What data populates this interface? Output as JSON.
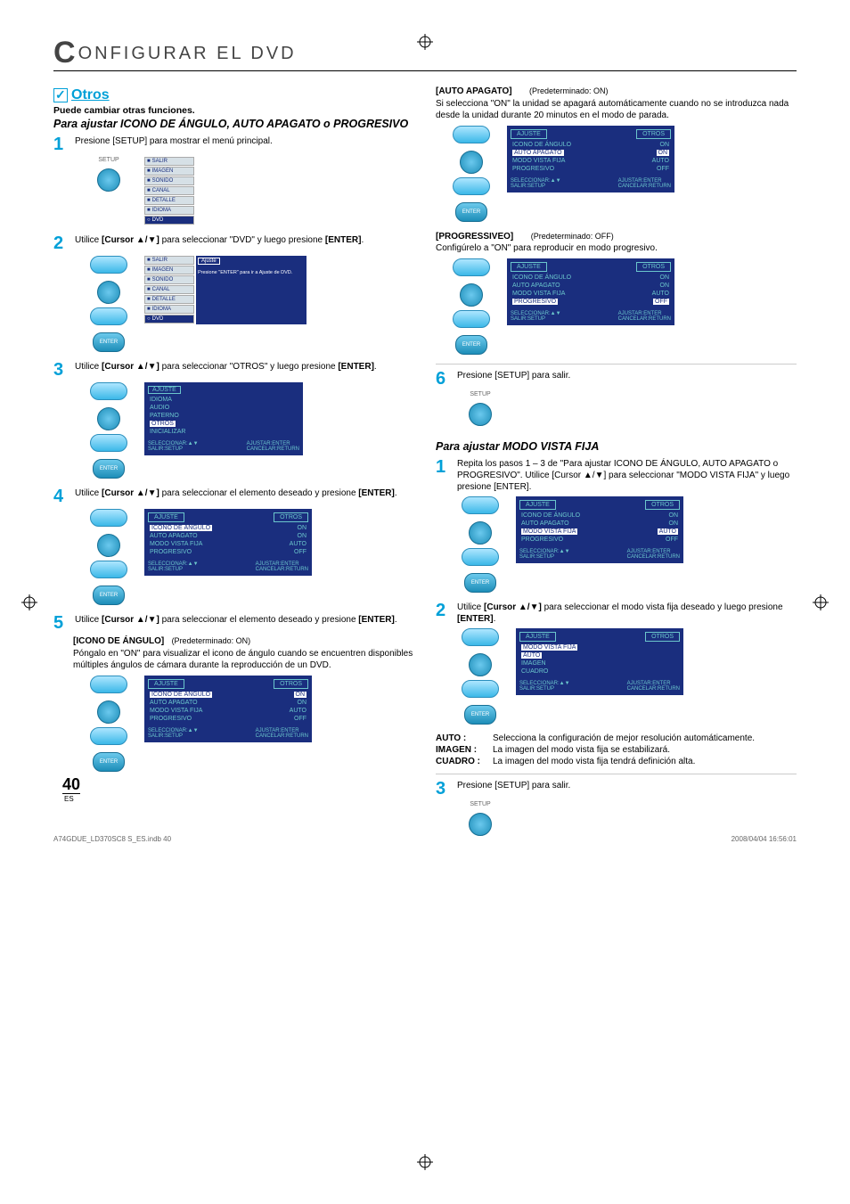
{
  "chapter": "ONFIGURAR EL DVD",
  "chapter_prefix": "C",
  "section": {
    "title": "Otros",
    "subtitle": "Puede cambiar otras funciones.",
    "subsection1": "Para ajustar ICONO DE ÁNGULO, AUTO APAGATO o PROGRESIVO",
    "subsection2": "Para ajustar MODO VISTA FIJA"
  },
  "steps_left": {
    "s1": "Presione [SETUP] para mostrar el menú principal.",
    "s2_a": "Utilice ",
    "s2_b": "[Cursor ▲/▼]",
    "s2_c": " para seleccionar \"DVD\" y luego presione ",
    "s2_d": "[ENTER]",
    "s2_e": ".",
    "s3_a": "Utilice ",
    "s3_b": "[Cursor ▲/▼]",
    "s3_c": " para seleccionar \"OTROS\" y luego presione ",
    "s3_d": "[ENTER]",
    "s3_e": ".",
    "s4_a": "Utilice ",
    "s4_b": "[Cursor ▲/▼]",
    "s4_c": " para seleccionar el elemento deseado y presione ",
    "s4_d": "[ENTER]",
    "s4_e": ".",
    "s5_a": "Utilice ",
    "s5_b": "[Cursor ▲/▼]",
    "s5_c": " para seleccionar el elemento deseado y presione ",
    "s5_d": "[ENTER]",
    "s5_e": "."
  },
  "icono": {
    "label": "[ICONO DE ÁNGULO]",
    "default": "(Predeterminado: ON)",
    "desc": "Póngalo en \"ON\" para visualizar el icono de ángulo cuando se encuentren disponibles múltiples ángulos de cámara durante la reproducción de un DVD."
  },
  "auto_apagato": {
    "label": "[AUTO APAGATO]",
    "default": "(Predeterminado: ON)",
    "desc": "Si selecciona \"ON\" la unidad se apagará automáticamente cuando no se introduzca nada desde la unidad durante 20 minutos en el modo de parada."
  },
  "progressive": {
    "label": "[PROGRESSIVEO]",
    "default": "(Predeterminado: OFF)",
    "desc": "Configúrelo a \"ON\" para reproducir en modo progresivo."
  },
  "step6": "Presione [SETUP] para salir.",
  "mvf": {
    "s1": "Repita los pasos 1 – 3 de \"Para ajustar ICONO DE ÁNGULO, AUTO APAGATO o PROGRESIVO\". Utilice [Cursor ▲/▼] para seleccionar \"MODO VISTA FIJA\" y luego presione [ENTER].",
    "s2_a": "Utilice ",
    "s2_b": "[Cursor ▲/▼]",
    "s2_c": " para seleccionar el modo vista fija deseado y luego presione ",
    "s2_d": "[ENTER]",
    "s2_e": ".",
    "s3": "Presione [SETUP] para salir."
  },
  "options": {
    "auto_term": "AUTO",
    "auto_sep": " :",
    "auto_desc": "Selecciona la configuración de mejor resolución automáticamente.",
    "imagen_term": "IMAGEN",
    "imagen_sep": " :",
    "imagen_desc": "La imagen del modo vista fija se estabilizará.",
    "cuadro_term": "CUADRO",
    "cuadro_sep": " :",
    "cuadro_desc": "La imagen del modo vista fija tendrá definición alta."
  },
  "osd": {
    "ajuste": "AJUSTE",
    "otros": "OTROS",
    "mvf": "MODO VISTA FIJA",
    "icono": "ICONO DE ÁNGULO",
    "auto_ap": "AUTO APAGATO",
    "mvf_row": "MODO VISTA FIJA",
    "prog": "PROGRESIVO",
    "on": "ON",
    "off": "OFF",
    "auto": "AUTO",
    "imagen": "IMAGEN",
    "cuadro": "CUADRO",
    "sel": "SELECCIONAR:▲▼",
    "salir": "SALIR:SETUP",
    "ajustar": "AJUSTAR:ENTER",
    "cancelar": "CANCELAR:RETURN",
    "enter_hint": "Presione \"ENTER\" para ir a Ajuste de DVD.",
    "idioma": "IDIOMA",
    "audio": "AUDIO",
    "paterno": "PATERNO",
    "init": "INICIALIZAR",
    "ajuste_top": "Ajuste"
  },
  "menu": {
    "salir": "SALIR",
    "imagen": "IMAGEN",
    "sonido": "SONIDO",
    "canal": "CANAL",
    "detalle": "DETALLE",
    "idioma": "IDIOMA",
    "dvd": "DVD"
  },
  "labels": {
    "setup": "SETUP",
    "enter": "ENTER"
  },
  "page_num": "40",
  "page_lang": "ES",
  "footer_left": "A74GDUE_LD370SC8 S_ES.indb   40",
  "footer_right": "2008/04/04   16:56:01"
}
